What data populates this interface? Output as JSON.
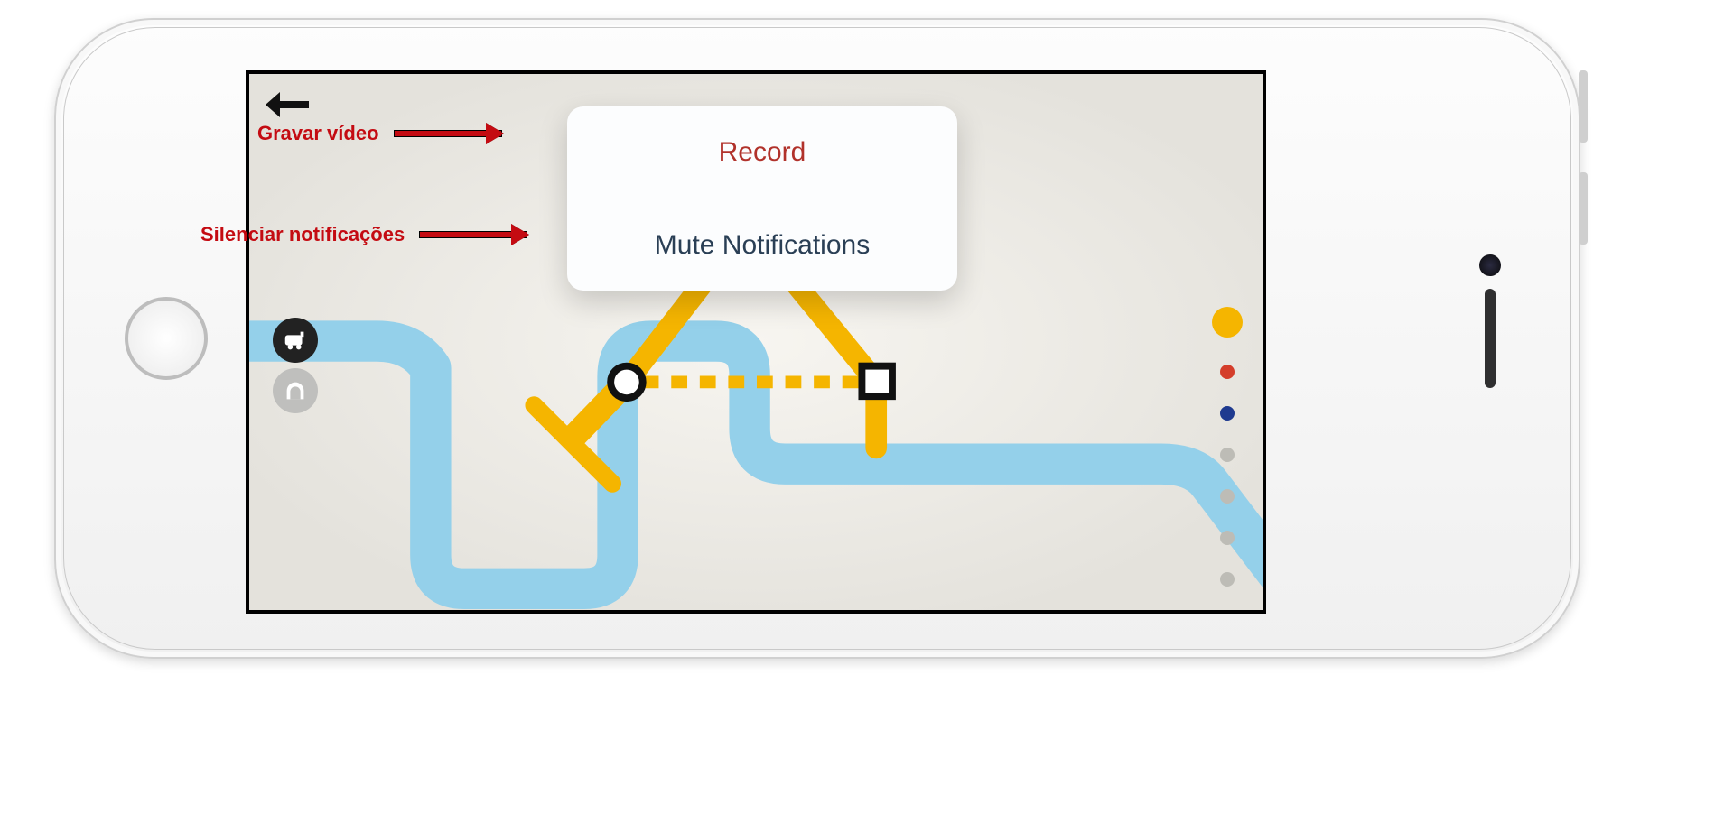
{
  "annotations": {
    "record_label": "Gravar vídeo",
    "mute_label": "Silenciar notificações"
  },
  "popup": {
    "record": "Record",
    "mute": "Mute Notifications"
  },
  "palette": {
    "colors": [
      "yellow",
      "red",
      "blue",
      "grey",
      "grey",
      "grey",
      "grey"
    ]
  },
  "icons": {
    "back": "back-arrow",
    "train_badge": "train",
    "tunnel_badge": "tunnel"
  }
}
